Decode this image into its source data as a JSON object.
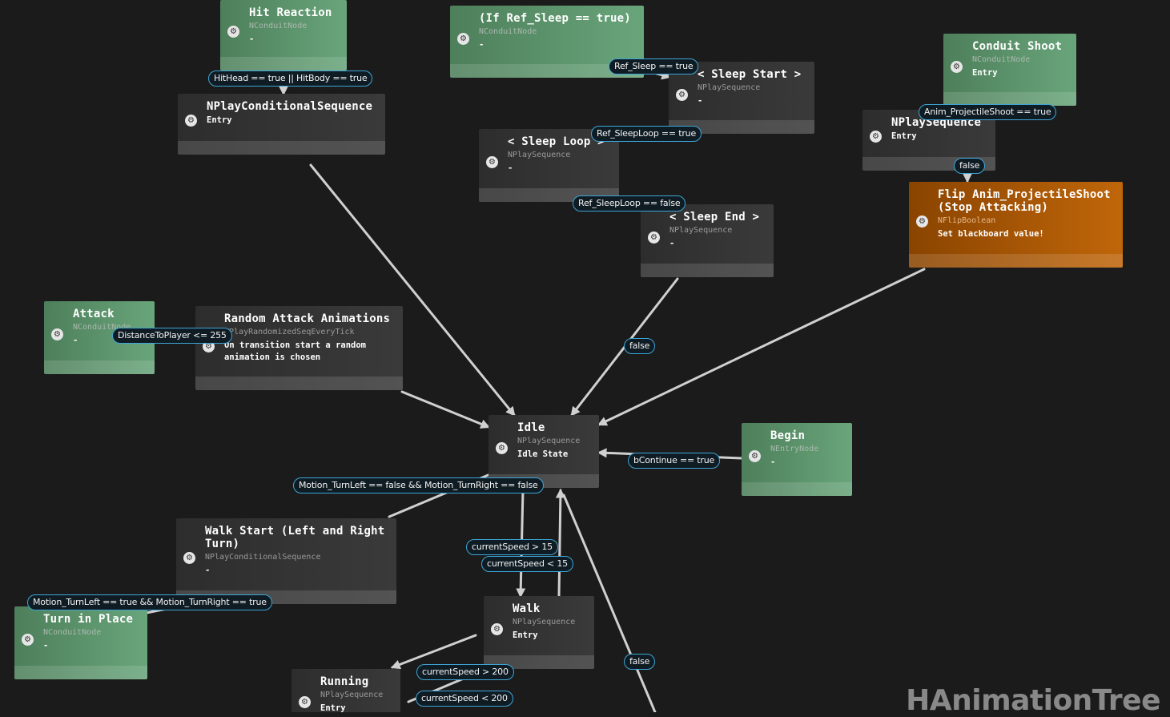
{
  "app": {
    "watermark": "HAnimationTree"
  },
  "colors": {
    "background": "#1b1b1b",
    "conduit_green": "#5d9a6c",
    "sequence_gray": "#333333",
    "flip_orange": "#b35b00",
    "condition_border": "#3ea5d6",
    "wire": "#d0d0d0"
  },
  "icons": {
    "node_pin": "gear-icon"
  },
  "nodes": {
    "hit_reaction": {
      "title": "Hit Reaction",
      "type": "NConduitNode",
      "desc": "-"
    },
    "if_ref_sleep": {
      "title": "(If Ref_Sleep == true)",
      "type": "NConduitNode",
      "desc": "-"
    },
    "conduit_shoot": {
      "title": "Conduit Shoot",
      "type": "NConduitNode",
      "desc": "Entry"
    },
    "nplay_conditional": {
      "title": "NPlayConditionalSequence",
      "type": "",
      "desc": "Entry"
    },
    "sleep_start": {
      "title": "< Sleep Start >",
      "type": "NPlaySequence",
      "desc": "-"
    },
    "nplay_sequence": {
      "title": "NPlaySequence",
      "type": "",
      "desc": "Entry"
    },
    "sleep_loop": {
      "title": "< Sleep Loop >",
      "type": "NPlaySequence",
      "desc": "-"
    },
    "flip_anim": {
      "title": "Flip Anim_ProjectileShoot (Stop Attacking)",
      "type": "NFlipBoolean",
      "desc": "Set blackboard value!"
    },
    "sleep_end": {
      "title": "< Sleep End >",
      "type": "NPlaySequence",
      "desc": "-"
    },
    "attack": {
      "title": "Attack",
      "type": "NConduitNode",
      "desc": "-"
    },
    "random_attack": {
      "title": "Random Attack Animations",
      "type": "NPlayRandomizedSeqEveryTick",
      "desc": "On transition start a random animation is chosen"
    },
    "idle": {
      "title": "Idle",
      "type": "NPlaySequence",
      "desc": "Idle State"
    },
    "begin": {
      "title": "Begin",
      "type": "NEntryNode",
      "desc": "-"
    },
    "walk_start": {
      "title": "Walk Start (Left and Right Turn)",
      "type": "NPlayConditionalSequence",
      "desc": "-"
    },
    "turn_in_place": {
      "title": "Turn in Place",
      "type": "NConduitNode",
      "desc": "-"
    },
    "walk": {
      "title": "Walk",
      "type": "NPlaySequence",
      "desc": "Entry"
    },
    "running": {
      "title": "Running",
      "type": "NPlaySequence",
      "desc": "Entry"
    }
  },
  "conditions": {
    "hit": "HitHead == true || HitBody == true",
    "ref_sleep": "Ref_Sleep == true",
    "anim_shoot": "Anim_ProjectileShoot == true",
    "sleeploop_true": "Ref_SleepLoop == true",
    "shoot_false": "false",
    "sleeploop_false": "Ref_SleepLoop == false",
    "distance": "DistanceToPlayer <= 255",
    "end_false": "false",
    "bcontinue": "bContinue == true",
    "motion_false": "Motion_TurnLeft == false && Motion_TurnRight == false",
    "speed_gt15": "currentSpeed > 15",
    "speed_lt15": "currentSpeed < 15",
    "motion_true": "Motion_TurnLeft == true && Motion_TurnRight == true",
    "bottom_false": "false",
    "speed_gt200": "currentSpeed > 200",
    "speed_lt200": "currentSpeed < 200"
  }
}
